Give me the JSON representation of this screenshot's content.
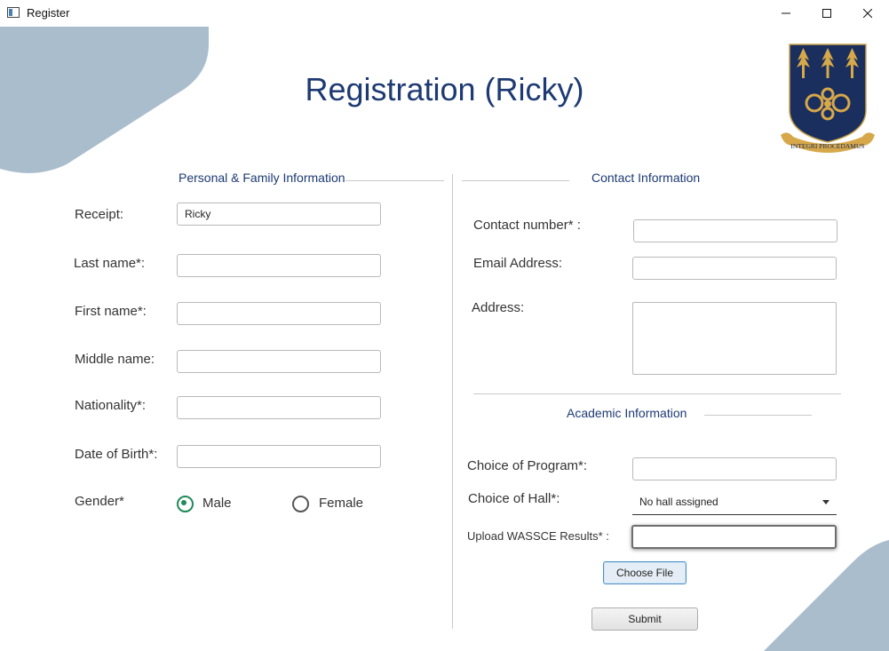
{
  "window": {
    "title": "Register"
  },
  "page": {
    "title": "Registration (Ricky)"
  },
  "crest": {
    "motto": "INTEGRI PROCEDAMUS"
  },
  "personal": {
    "heading": "Personal & Family Information",
    "receipt_label": "Receipt:",
    "receipt_value": "Ricky",
    "last_name_label": "Last name*:",
    "last_name_value": "",
    "first_name_label": "First name*:",
    "first_name_value": "",
    "middle_name_label": "Middle name:",
    "middle_name_value": "",
    "nationality_label": "Nationality*:",
    "nationality_value": "",
    "dob_label": "Date of Birth*:",
    "dob_value": "",
    "gender_label": "Gender*",
    "gender_options": [
      "Male",
      "Female"
    ],
    "gender_selected": "Male"
  },
  "contact": {
    "heading": "Contact Information",
    "contact_number_label": "Contact number* :",
    "contact_number_value": "",
    "email_label": "Email Address:",
    "email_value": "",
    "address_label": "Address:",
    "address_value": ""
  },
  "academic": {
    "heading": "Academic Information",
    "program_label": "Choice of Program*:",
    "program_value": "",
    "hall_label": "Choice of Hall*:",
    "hall_value": "No hall assigned",
    "upload_label": "Upload WASSCE Results* :",
    "upload_value": "",
    "choose_file_label": "Choose File",
    "submit_label": "Submit"
  },
  "colors": {
    "accent": "#1d3a73",
    "decoration": "#aabdcd",
    "radio_selected": "#1f8a57",
    "crest_navy": "#1a2f5e",
    "crest_gold": "#d7a84a"
  }
}
